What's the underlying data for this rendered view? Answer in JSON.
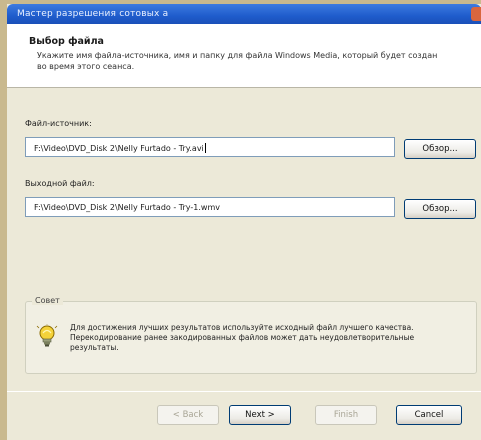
{
  "window": {
    "title": "Мастер разрешения сотовых a"
  },
  "header": {
    "title": "Выбор файла",
    "description": "Укажите имя файла-источника, имя и папку для файла Windows Media, который будет создан во время этого сеанса."
  },
  "source": {
    "label": "Файл-источник:",
    "value": "F:\\Video\\DVD_Disk 2\\Nelly Furtado - Try.avi",
    "browse_label": "Обзор..."
  },
  "output": {
    "label": "Выходной файл:",
    "value": "F:\\Video\\DVD_Disk 2\\Nelly Furtado - Try-1.wmv",
    "browse_label": "Обзор..."
  },
  "tip": {
    "legend": "Совет",
    "text": "Для достижения лучших результатов используйте исходный файл лучшего качества. Перекодирование ранее закодированных файлов может дать неудовлетворительные результаты.",
    "icon": "lightbulb-icon"
  },
  "footer": {
    "back_label": "< Back",
    "next_label": "Next >",
    "finish_label": "Finish",
    "cancel_label": "Cancel"
  }
}
